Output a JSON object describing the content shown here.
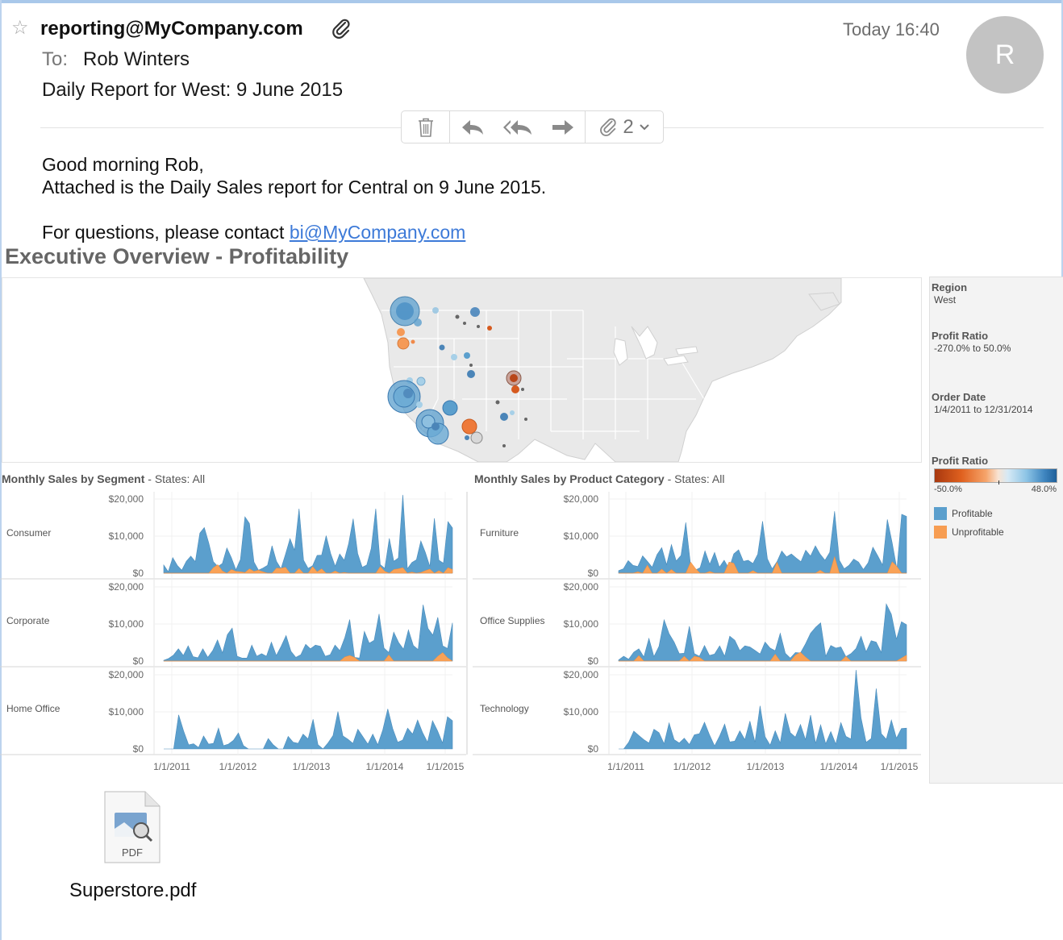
{
  "email": {
    "from": "reporting@MyCompany.com",
    "time": "Today 16:40",
    "avatar_initial": "R",
    "to_label": "To:",
    "to_name": "Rob Winters",
    "subject": "Daily Report for West: 9 June 2015",
    "attachment_count": "2",
    "greeting": "Good morning Rob,",
    "body_line": "Attached is the Daily Sales report for Central on 9 June 2015.",
    "contact_prefix": "For questions, please contact ",
    "contact_link": "bi@MyCompany.com"
  },
  "dashboard": {
    "title": "Executive Overview - Profitability",
    "filters": [
      {
        "label": "Region",
        "value": "West"
      },
      {
        "label": "Profit Ratio",
        "value": "-270.0% to 50.0%"
      },
      {
        "label": "Order Date",
        "value": "1/4/2011 to 12/31/2014"
      }
    ],
    "color_legend": {
      "title": "Profit Ratio",
      "min_label": "-50.0%",
      "max_label": "48.0%",
      "items": [
        {
          "label": "Profitable",
          "color": "#5b9fcd"
        },
        {
          "label": "Unprofitable",
          "color": "#f79d52"
        }
      ]
    },
    "colors": {
      "profitable": "#5b9fcd",
      "unprofitable": "#f9a257",
      "negative": "#b8461a"
    }
  },
  "chart_data": [
    {
      "type": "area",
      "title": "Monthly Sales by Segment",
      "subtitle": "States: All",
      "y_ticks": [
        "$20,000",
        "$10,000",
        "$0"
      ],
      "x_ticks": [
        "1/1/2011",
        "1/1/2012",
        "1/1/2013",
        "1/1/2014",
        "1/1/2015"
      ],
      "ylim": [
        0,
        20000
      ],
      "panels": [
        {
          "name": "Consumer",
          "profitable": [
            2200,
            400,
            4200,
            2100,
            800,
            3200,
            4600,
            3100,
            10800,
            12300,
            8100,
            3100,
            1800,
            2600,
            6800,
            4200,
            900,
            3700,
            15200,
            13400,
            3000,
            800,
            1400,
            2100,
            7400,
            3200,
            1200,
            5100,
            9300,
            6200,
            17400,
            3500,
            1300,
            2000,
            4800,
            4900,
            10100,
            5300,
            1900,
            5200,
            3500,
            8000,
            14700,
            5300,
            1600,
            2200,
            6700,
            17400,
            2300,
            1300,
            9400,
            3200,
            4100,
            21100,
            1200,
            2900,
            3600,
            8700,
            5600,
            1800,
            14800,
            3500,
            2700,
            13900,
            12200
          ],
          "unprofitable": [
            0,
            0,
            0,
            0,
            0,
            0,
            0,
            0,
            0,
            0,
            0,
            1500,
            2300,
            600,
            0,
            1000,
            500,
            400,
            200,
            1200,
            500,
            800,
            400,
            0,
            0,
            1400,
            1300,
            1600,
            0,
            0,
            1300,
            0,
            0,
            1800,
            400,
            1200,
            0,
            0,
            600,
            0,
            200,
            0,
            0,
            0,
            0,
            0,
            0,
            0,
            1800,
            500,
            0,
            1000,
            1200,
            1500,
            0,
            300,
            0,
            200,
            700,
            1100,
            0,
            700,
            0,
            1500,
            1000
          ]
        },
        {
          "name": "Corporate",
          "profitable": [
            200,
            700,
            1600,
            3300,
            1500,
            4100,
            1200,
            900,
            3300,
            1000,
            2800,
            5700,
            2200,
            7100,
            8900,
            1300,
            800,
            800,
            4300,
            1300,
            2000,
            1300,
            5100,
            1500,
            4000,
            6900,
            2600,
            1000,
            1700,
            4500,
            3300,
            4300,
            4000,
            1300,
            1700,
            4300,
            2800,
            6300,
            11200,
            1000,
            800,
            8000,
            4800,
            5600,
            12700,
            3500,
            2300,
            7800,
            5000,
            3200,
            8400,
            4200,
            3100,
            15200,
            8800,
            7000,
            11800,
            4100,
            3400,
            10300
          ],
          "unprofitable": [
            0,
            0,
            0,
            0,
            0,
            0,
            0,
            0,
            0,
            0,
            0,
            0,
            0,
            0,
            0,
            0,
            0,
            0,
            0,
            0,
            0,
            0,
            0,
            0,
            0,
            0,
            0,
            0,
            0,
            0,
            0,
            0,
            0,
            0,
            0,
            0,
            0,
            1100,
            1500,
            1000,
            0,
            0,
            0,
            0,
            0,
            0,
            1700,
            0,
            0,
            0,
            0,
            0,
            0,
            0,
            0,
            0,
            1300,
            2300,
            900,
            0
          ]
        },
        {
          "name": "Home Office",
          "profitable": [
            0,
            0,
            0,
            9200,
            4800,
            1100,
            1400,
            400,
            3500,
            1300,
            1500,
            5600,
            900,
            1300,
            2300,
            4300,
            900,
            0,
            0,
            0,
            0,
            2800,
            1100,
            0,
            0,
            3400,
            1800,
            1500,
            4000,
            2700,
            8000,
            1100,
            0,
            1600,
            3600,
            10100,
            3500,
            2600,
            1500,
            5300,
            3300,
            1300,
            4000,
            1100,
            5100,
            10800,
            5500,
            1800,
            2400,
            5600,
            4000,
            7800,
            4400,
            1800,
            7600,
            4900,
            1600,
            8700,
            7600
          ],
          "unprofitable": [
            0,
            0,
            0,
            0,
            0,
            0,
            0,
            0,
            0,
            0,
            0,
            0,
            0,
            0,
            0,
            0,
            0,
            0,
            0,
            0,
            0,
            0,
            0,
            0,
            0,
            0,
            0,
            0,
            0,
            0,
            0,
            0,
            0,
            0,
            0,
            0,
            0,
            0,
            0,
            0,
            0,
            0,
            0,
            0,
            0,
            0,
            0,
            0,
            0,
            0,
            0,
            0,
            0,
            0,
            0,
            0,
            0,
            0,
            0
          ]
        }
      ]
    },
    {
      "type": "area",
      "title": "Monthly Sales by Product Category",
      "subtitle": "States: All",
      "y_ticks": [
        "$20,000",
        "$10,000",
        "$0"
      ],
      "x_ticks": [
        "1/1/2011",
        "1/1/2012",
        "1/1/2013",
        "1/1/2014",
        "1/1/2015"
      ],
      "ylim": [
        0,
        20000
      ],
      "panels": [
        {
          "name": "Furniture",
          "profitable": [
            700,
            1200,
            3400,
            2100,
            1800,
            4700,
            3200,
            1600,
            5000,
            6900,
            2300,
            7700,
            3300,
            4800,
            13700,
            2100,
            800,
            1500,
            6000,
            2400,
            5600,
            1600,
            3500,
            1200,
            5200,
            6300,
            3200,
            3500,
            2600,
            5100,
            14000,
            3900,
            1200,
            3100,
            6000,
            4400,
            5200,
            4100,
            3100,
            6200,
            4600,
            7400,
            5100,
            3500,
            5600,
            16700,
            3500,
            1200,
            2100,
            3800,
            3000,
            1000,
            2800,
            7000,
            4700,
            2200,
            14500,
            8200,
            1100,
            15900,
            15300
          ],
          "unprofitable": [
            0,
            0,
            0,
            0,
            400,
            0,
            2200,
            0,
            0,
            1100,
            0,
            1000,
            0,
            0,
            0,
            3000,
            1300,
            0,
            0,
            500,
            0,
            0,
            0,
            3000,
            2700,
            0,
            0,
            0,
            700,
            0,
            0,
            0,
            0,
            3000,
            0,
            0,
            0,
            0,
            0,
            0,
            0,
            0,
            800,
            0,
            0,
            4500,
            0,
            0,
            0,
            0,
            0,
            0,
            0,
            0,
            0,
            0,
            0,
            3100,
            1800,
            0,
            0
          ]
        },
        {
          "name": "Office Supplies",
          "profitable": [
            300,
            1300,
            500,
            2400,
            3300,
            1100,
            6100,
            1200,
            4000,
            11100,
            7400,
            5100,
            2000,
            2100,
            9400,
            2000,
            1300,
            4200,
            1500,
            1900,
            4100,
            1300,
            6700,
            5600,
            2800,
            4100,
            3800,
            2900,
            1900,
            5100,
            3500,
            2800,
            7500,
            2100,
            800,
            2300,
            2200,
            4600,
            7500,
            9100,
            10300,
            1300,
            4200,
            3500,
            3800,
            1200,
            2000,
            3400,
            6700,
            2500,
            5500,
            5100,
            2300,
            15400,
            12600,
            5900,
            10600,
            9800
          ],
          "unprofitable": [
            0,
            0,
            0,
            0,
            1500,
            0,
            0,
            0,
            0,
            0,
            0,
            0,
            0,
            1300,
            0,
            1300,
            1000,
            0,
            0,
            0,
            0,
            0,
            0,
            0,
            0,
            0,
            0,
            0,
            0,
            0,
            0,
            1900,
            0,
            0,
            0,
            1600,
            2400,
            1100,
            0,
            0,
            0,
            0,
            0,
            0,
            0,
            1300,
            0,
            0,
            0,
            0,
            0,
            0,
            0,
            0,
            0,
            0,
            800,
            1600
          ]
        },
        {
          "name": "Technology",
          "profitable": [
            0,
            0,
            1800,
            4800,
            3600,
            2500,
            1600,
            5300,
            4400,
            1400,
            7000,
            2500,
            1600,
            2900,
            1200,
            3800,
            4100,
            7200,
            3800,
            800,
            3500,
            6700,
            1900,
            2100,
            4900,
            2500,
            7500,
            1800,
            11600,
            3300,
            1000,
            4900,
            1600,
            9600,
            4400,
            3200,
            6600,
            2500,
            9100,
            1500,
            6500,
            1400,
            4700,
            1300,
            7100,
            3400,
            2700,
            21300,
            8400,
            1800,
            2800,
            16300,
            4100,
            2600,
            7800,
            2900,
            5500,
            5600
          ],
          "unprofitable": [
            0,
            0,
            0,
            0,
            0,
            0,
            0,
            0,
            0,
            0,
            0,
            0,
            0,
            0,
            0,
            0,
            0,
            0,
            0,
            0,
            0,
            0,
            0,
            0,
            0,
            0,
            0,
            0,
            0,
            0,
            0,
            0,
            0,
            0,
            0,
            0,
            0,
            0,
            0,
            0,
            0,
            0,
            0,
            0,
            0,
            0,
            0,
            0,
            0,
            0,
            0,
            0,
            0,
            0,
            0,
            0,
            0,
            0
          ]
        }
      ]
    }
  ],
  "map_data": {
    "type": "symbol-map",
    "region": "West"
  },
  "attachment": {
    "file_name": "Superstore.pdf",
    "file_type": "PDF"
  }
}
